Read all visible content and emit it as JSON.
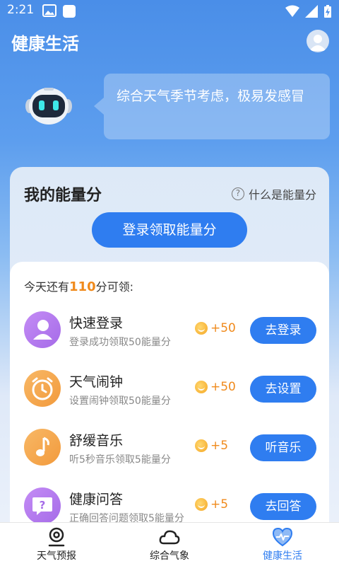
{
  "status_bar": {
    "time": "2:21"
  },
  "header": {
    "title": "健康生活",
    "avatar_icon": "user-avatar-icon"
  },
  "assistant": {
    "message": "综合天气季节考虑，极易发感冒"
  },
  "energy": {
    "title": "我的能量分",
    "help_label": "什么是能量分",
    "login_button": "登录领取能量分",
    "remain_prefix": "今天还有",
    "remain_value": "110",
    "remain_suffix": "分可领:",
    "tasks": [
      {
        "name": "快速登录",
        "desc": "登录成功领取50能量分",
        "reward": "+50",
        "button": "去登录",
        "icon": "user-icon",
        "color": "#b57bf0"
      },
      {
        "name": "天气闹钟",
        "desc": "设置闹钟领取50能量分",
        "reward": "+50",
        "button": "去设置",
        "icon": "alarm-clock-icon",
        "color": "#f5a24a"
      },
      {
        "name": "舒缓音乐",
        "desc": "听5秒音乐领取5能量分",
        "reward": "+5",
        "button": "听音乐",
        "icon": "music-note-icon",
        "color": "#f5a24a"
      },
      {
        "name": "健康问答",
        "desc": "正确回答问题领取5能量分",
        "reward": "+5",
        "button": "去回答",
        "icon": "question-bubble-icon",
        "color": "#b57bf0"
      }
    ]
  },
  "nav": {
    "items": [
      {
        "label": "天气预报",
        "icon": "location-pin-icon",
        "active": false
      },
      {
        "label": "综合气象",
        "icon": "cloud-icon",
        "active": false
      },
      {
        "label": "健康生活",
        "icon": "heart-pulse-icon",
        "active": true
      }
    ]
  },
  "colors": {
    "accent": "#2f7df0",
    "reward": "#f08a1c"
  }
}
